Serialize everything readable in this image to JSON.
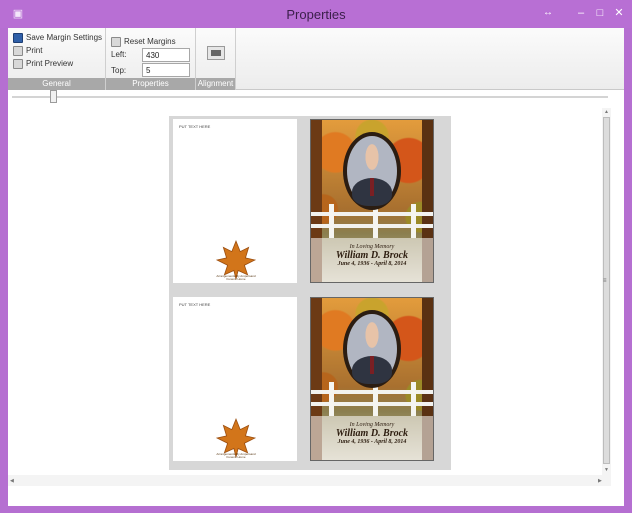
{
  "window": {
    "title": "Properties",
    "accent": "#b86fd4"
  },
  "ribbon": {
    "general": {
      "label": "General",
      "save_margin": "Save Margin Settings",
      "print": "Print",
      "print_preview": "Print Preview"
    },
    "properties": {
      "label": "Properties",
      "reset_margins": "Reset Margins",
      "left_label": "Left:",
      "left_value": "430",
      "top_label": "Top:",
      "top_value": "5"
    },
    "alignment": {
      "label": "Alignment"
    }
  },
  "zoom_slider_icon": "slider-thumb",
  "pages": {
    "inside_text": "PUT TEXT HERE",
    "leaf_caption": "Arrangements By Ampersand Funeral Home",
    "cover": {
      "subtitle": "In Loving Memory",
      "name": "William D. Brock",
      "dates": "June 4, 1936 - April 8, 2014"
    }
  },
  "icons": {
    "app": "printer-icon",
    "resize": "resize-icon",
    "minimize": "minimize-icon",
    "maximize": "maximize-icon",
    "close": "close-icon"
  }
}
